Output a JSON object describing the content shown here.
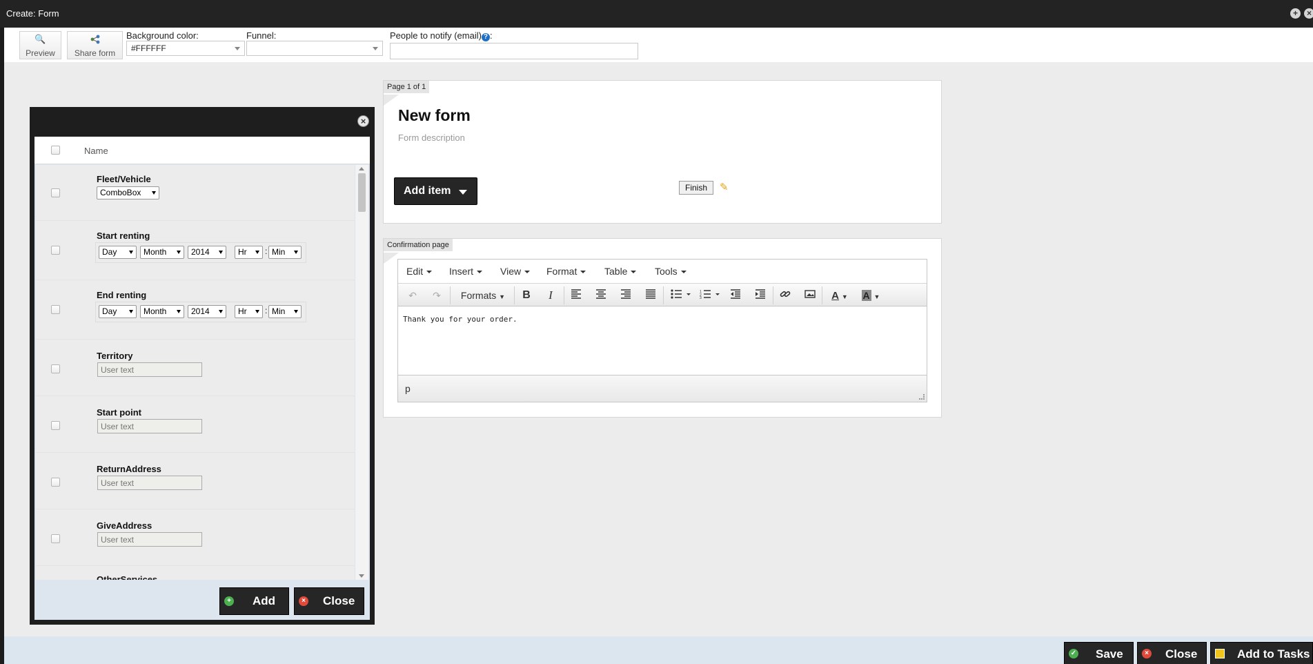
{
  "window": {
    "title": "Create: Form"
  },
  "toolbar": {
    "preview_label": "Preview",
    "share_label": "Share form",
    "bg_color_label": "Background color:",
    "bg_color_value": "#FFFFFF",
    "funnel_label": "Funnel:",
    "funnel_value": "",
    "notify_label": "People to notify (email)",
    "notify_suffix": ":",
    "notify_value": ""
  },
  "form_card": {
    "page_tab": "Page 1 of 1",
    "title": "New form",
    "description": "Form description",
    "add_item_label": "Add item",
    "finish_label": "Finish"
  },
  "confirm_card": {
    "tab": "Confirmation page",
    "menus": [
      "Edit",
      "Insert",
      "View",
      "Format",
      "Table",
      "Tools"
    ],
    "formats_label": "Formats",
    "content": "Thank you for your order.",
    "status_path": "p"
  },
  "dialog": {
    "column_name": "Name",
    "rows": [
      {
        "name": "Fleet/Vehicle",
        "combo": "ComboBox"
      },
      {
        "name": "Start renting",
        "day": "Day",
        "month": "Month",
        "year": "2014",
        "hour": "Hr",
        "sep": ":",
        "minute": "Min"
      },
      {
        "name": "End renting",
        "day": "Day",
        "month": "Month",
        "year": "2014",
        "hour": "Hr",
        "sep": ":",
        "minute": "Min"
      },
      {
        "name": "Territory",
        "placeholder": "User text"
      },
      {
        "name": "Start point",
        "placeholder": "User text"
      },
      {
        "name": "ReturnAddress",
        "placeholder": "User text"
      },
      {
        "name": "GiveAddress",
        "placeholder": "User text"
      },
      {
        "name": "OtherServices"
      }
    ],
    "add_label": "Add",
    "close_label": "Close"
  },
  "footer": {
    "save_label": "Save",
    "close_label": "Close",
    "tasks_label": "Add to Tasks"
  },
  "colors": {
    "titlebar": "#232323",
    "dark_button": "#262626",
    "accent_blue": "#1f6fc5",
    "save_icon": "#4caf50",
    "close_icon": "#e04a3b"
  }
}
